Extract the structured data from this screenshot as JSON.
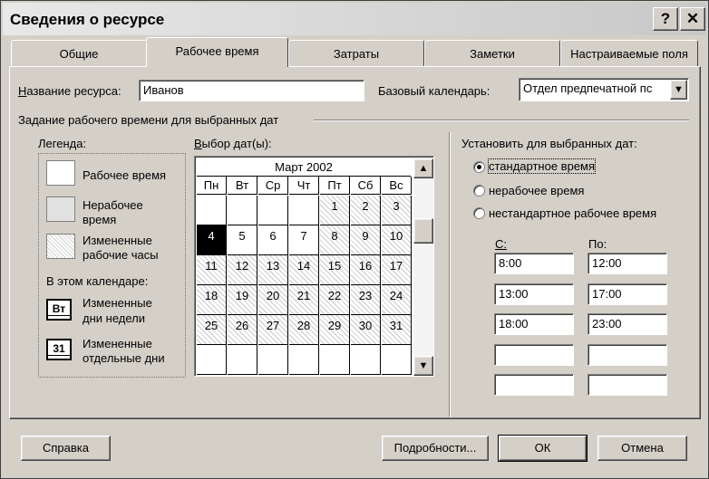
{
  "window": {
    "title": "Сведения о ресурсе",
    "help_glyph": "?",
    "close_glyph": "✕"
  },
  "tabs": [
    {
      "label": "Общие",
      "active": false
    },
    {
      "label": "Рабочее время",
      "active": true
    },
    {
      "label": "Затраты",
      "active": false
    },
    {
      "label": "Заметки",
      "active": false
    },
    {
      "label": "Настраиваемые поля",
      "active": false
    }
  ],
  "resource": {
    "name_label": "Название ресурса:",
    "name_value": "Иванов",
    "base_calendar_label": "Базовый календарь:",
    "base_calendar_value": "Отдел предпечатной пс",
    "dropdown_glyph": "▼"
  },
  "group_title": "Задание рабочего времени для выбранных дат",
  "legend": {
    "title": "Легенда:",
    "working": "Рабочее время",
    "nonworking_1": "Нерабочее",
    "nonworking_2": "время",
    "changed_1": "Измененные",
    "changed_2": "рабочие часы",
    "in_calendar": "В этом календаре:",
    "weekday_badge": "Вт",
    "weekday_1": "Измененные",
    "weekday_2": "дни недели",
    "day_badge": "31",
    "day_1": "Измененные",
    "day_2": "отдельные дни"
  },
  "calendar": {
    "label": "Выбор дат(ы):",
    "month": "Март 2002",
    "weekdays": [
      "Пн",
      "Вт",
      "Ср",
      "Чт",
      "Пт",
      "Сб",
      "Вс"
    ],
    "weeks": [
      [
        "",
        "",
        "",
        "",
        "1",
        "2",
        "3"
      ],
      [
        "4",
        "5",
        "6",
        "7",
        "8",
        "9",
        "10"
      ],
      [
        "11",
        "12",
        "13",
        "14",
        "15",
        "16",
        "17"
      ],
      [
        "18",
        "19",
        "20",
        "21",
        "22",
        "23",
        "24"
      ],
      [
        "25",
        "26",
        "27",
        "28",
        "29",
        "30",
        "31"
      ],
      [
        "",
        "",
        "",
        "",
        "",
        "",
        ""
      ]
    ],
    "selected_day": "4",
    "scroll_up": "▲",
    "scroll_down": "▼"
  },
  "settings": {
    "title": "Установить для выбранных дат:",
    "options": [
      {
        "label": "стандартное время",
        "selected": true
      },
      {
        "label": "нерабочее время",
        "selected": false
      },
      {
        "label": "нестандартное рабочее время",
        "selected": false
      }
    ],
    "from_label": "С:",
    "to_label": "По:",
    "times": [
      {
        "from": "8:00",
        "to": "12:00"
      },
      {
        "from": "13:00",
        "to": "17:00"
      },
      {
        "from": "18:00",
        "to": "23:00"
      },
      {
        "from": "",
        "to": ""
      },
      {
        "from": "",
        "to": ""
      }
    ]
  },
  "buttons": {
    "help": "Справка",
    "details": "Подробности...",
    "ok": "ОК",
    "cancel": "Отмена"
  }
}
